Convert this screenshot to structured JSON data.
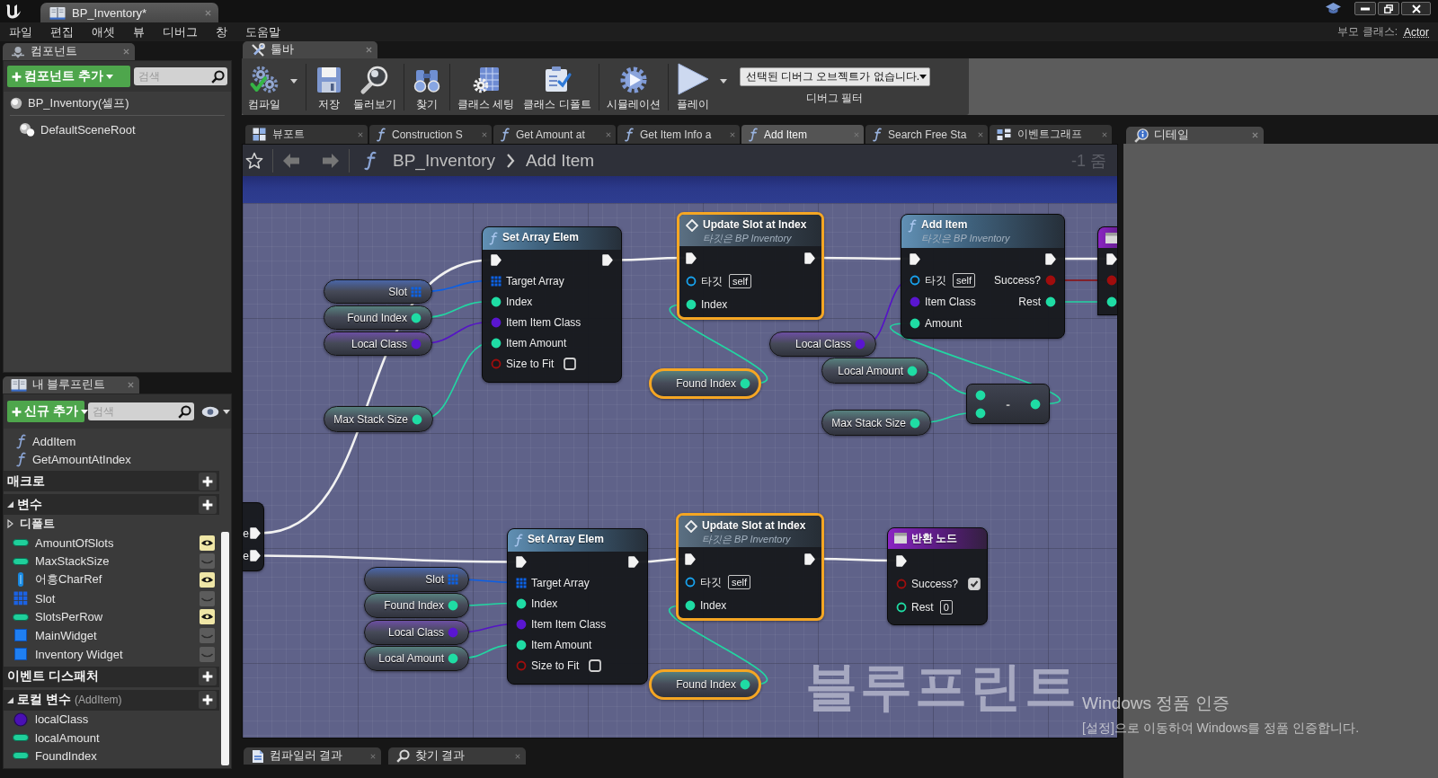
{
  "title_bar": {
    "tab": "BP_Inventory*"
  },
  "menu": [
    "파일",
    "편집",
    "애셋",
    "뷰",
    "디버그",
    "창",
    "도움말"
  ],
  "parent_class": {
    "label": "부모 클래스:",
    "value": "Actor"
  },
  "components": {
    "tab": "컴포넌트",
    "add_button": "컴포넌트 추가",
    "search": {
      "placeholder": "검색"
    },
    "items": [
      {
        "label": "BP_Inventory(셀프)",
        "kind": "actor",
        "children": [
          {
            "label": "DefaultSceneRoot",
            "kind": "scene"
          }
        ]
      }
    ]
  },
  "toolbar": {
    "tab": "툴바",
    "groups": [
      {
        "buttons": [
          {
            "label": "컴파일",
            "kind": "compile",
            "dropdown": true
          }
        ]
      },
      {
        "buttons": [
          {
            "label": "저장",
            "kind": "save",
            "dropdown": false
          },
          {
            "label": "둘러보기",
            "kind": "browse",
            "dropdown": false
          }
        ]
      },
      {
        "buttons": [
          {
            "label": "찾기",
            "kind": "find",
            "dropdown": false
          }
        ]
      },
      {
        "buttons": [
          {
            "label": "클래스 세팅",
            "kind": "class_settings",
            "dropdown": false
          },
          {
            "label": "클래스 디폴트",
            "kind": "class_defaults",
            "dropdown": false
          }
        ]
      },
      {
        "buttons": [
          {
            "label": "시뮬레이션",
            "kind": "simulate",
            "dropdown": false
          }
        ]
      },
      {
        "buttons": [
          {
            "label": "플레이",
            "kind": "play",
            "dropdown": true
          }
        ]
      }
    ],
    "debug_filter": {
      "value": "선택된 디버그 오브젝트가 없습니다.",
      "label": "디버그 필터"
    }
  },
  "document_tabs": [
    {
      "label": "뷰포트",
      "kind": "viewport",
      "selected": false
    },
    {
      "label": "Construction S",
      "kind": "function",
      "selected": false
    },
    {
      "label": "Get Amount at",
      "kind": "function",
      "selected": false
    },
    {
      "label": "Get Item Info a",
      "kind": "function",
      "selected": false
    },
    {
      "label": "Add Item",
      "kind": "function",
      "selected": true
    },
    {
      "label": "Search Free Sta",
      "kind": "function",
      "selected": false
    },
    {
      "label": "이벤트그래프",
      "kind": "graph",
      "selected": false
    }
  ],
  "details": {
    "tab": "디테일"
  },
  "breadcrumb": {
    "path": [
      "BP_Inventory",
      "Add Item"
    ],
    "zoom": "-1 줌"
  },
  "graph": {
    "nodes": [
      {
        "kind": "cut_left",
        "outputs": [
          {
            "kind": "exec",
            "label": "e",
            "connected": true
          },
          {
            "kind": "exec",
            "label": "e",
            "connected": true
          }
        ]
      },
      {
        "kind": "variable",
        "label": "Slot",
        "pin": {
          "kind": "array",
          "connected": true
        },
        "selected": false
      },
      {
        "kind": "variable",
        "label": "Found Index",
        "pin": {
          "kind": "int",
          "connected": true
        },
        "selected": false
      },
      {
        "kind": "variable",
        "label": "Local Class",
        "pin": {
          "kind": "class",
          "connected": true
        },
        "selected": false
      },
      {
        "kind": "variable",
        "label": "Max Stack Size",
        "pin": {
          "kind": "int",
          "connected": true
        },
        "selected": false
      },
      {
        "kind": "function",
        "title": "Set Array Elem",
        "selected": false,
        "inputs": [
          {
            "kind": "exec",
            "connected": true
          },
          {
            "kind": "array",
            "label": "Target Array",
            "connected": true
          },
          {
            "kind": "int",
            "label": "Index",
            "connected": true
          },
          {
            "kind": "class",
            "label": "Item Item Class",
            "connected": true
          },
          {
            "kind": "int",
            "label": "Item Amount",
            "connected": true
          },
          {
            "kind": "bool",
            "label": "Size to Fit",
            "connected": false,
            "checked": false
          }
        ],
        "outputs": [
          {
            "kind": "exec",
            "connected": true
          }
        ]
      },
      {
        "kind": "message",
        "title": "Update Slot at Index",
        "subtitle": "타깃은 BP Inventory",
        "selected": true,
        "inputs": [
          {
            "kind": "exec",
            "connected": true
          },
          {
            "kind": "object",
            "label": "타깃",
            "value": "self",
            "connected": false
          },
          {
            "kind": "int",
            "label": "Index",
            "connected": true
          }
        ],
        "outputs": [
          {
            "kind": "exec",
            "connected": true
          }
        ]
      },
      {
        "kind": "variable",
        "label": "Found Index",
        "pin": {
          "kind": "int",
          "connected": true
        },
        "selected": true
      },
      {
        "kind": "function",
        "title": "Add Item",
        "subtitle": "타깃은 BP Inventory",
        "selected": false,
        "inputs": [
          {
            "kind": "exec",
            "connected": true
          },
          {
            "kind": "object",
            "label": "타깃",
            "value": "self",
            "connected": false
          },
          {
            "kind": "class",
            "label": "Item Class",
            "connected": true
          },
          {
            "kind": "int",
            "label": "Amount",
            "connected": true
          }
        ],
        "outputs": [
          {
            "kind": "exec",
            "connected": true
          },
          {
            "kind": "bool",
            "label": "Success?",
            "connected": true
          },
          {
            "kind": "int",
            "label": "Rest",
            "connected": true
          }
        ]
      },
      {
        "kind": "variable",
        "label": "Local Class",
        "pin": {
          "kind": "class",
          "connected": true
        },
        "selected": false
      },
      {
        "kind": "variable",
        "label": "Local Amount",
        "pin": {
          "kind": "int",
          "connected": true
        },
        "selected": false
      },
      {
        "kind": "variable",
        "label": "Max Stack Size",
        "pin": {
          "kind": "int",
          "connected": true
        },
        "selected": false
      },
      {
        "kind": "operator",
        "symbol": "-",
        "selected": false,
        "inputs": [
          {
            "kind": "int",
            "connected": true
          },
          {
            "kind": "int",
            "connected": true
          }
        ],
        "outputs": [
          {
            "kind": "int",
            "connected": true
          }
        ]
      },
      {
        "kind": "cut_right",
        "inputs": [
          {
            "kind": "exec",
            "connected": true
          },
          {
            "kind": "bool",
            "connected": true
          },
          {
            "kind": "int",
            "connected": true
          }
        ]
      },
      {
        "kind": "function",
        "title": "Set Array Elem",
        "selected": false,
        "inputs": [
          {
            "kind": "exec",
            "connected": true
          },
          {
            "kind": "array",
            "label": "Target Array",
            "connected": true
          },
          {
            "kind": "int",
            "label": "Index",
            "connected": true
          },
          {
            "kind": "class",
            "label": "Item Item Class",
            "connected": true
          },
          {
            "kind": "int",
            "label": "Item Amount",
            "connected": true
          },
          {
            "kind": "bool",
            "label": "Size to Fit",
            "connected": false,
            "checked": false
          }
        ],
        "outputs": [
          {
            "kind": "exec",
            "connected": true
          }
        ]
      },
      {
        "kind": "variable",
        "label": "Slot",
        "pin": {
          "kind": "array",
          "connected": true
        },
        "selected": false
      },
      {
        "kind": "variable",
        "label": "Found Index",
        "pin": {
          "kind": "int",
          "connected": true
        },
        "selected": false
      },
      {
        "kind": "variable",
        "label": "Local Class",
        "pin": {
          "kind": "class",
          "connected": true
        },
        "selected": false
      },
      {
        "kind": "variable",
        "label": "Local Amount",
        "pin": {
          "kind": "int",
          "connected": true
        },
        "selected": false
      },
      {
        "kind": "message",
        "title": "Update Slot at Index",
        "subtitle": "타깃은 BP Inventory",
        "selected": true,
        "inputs": [
          {
            "kind": "exec",
            "connected": true
          },
          {
            "kind": "object",
            "label": "타깃",
            "value": "self",
            "connected": false
          },
          {
            "kind": "int",
            "label": "Index",
            "connected": true
          }
        ],
        "outputs": [
          {
            "kind": "exec",
            "connected": true
          }
        ]
      },
      {
        "kind": "variable",
        "label": "Found Index",
        "pin": {
          "kind": "int",
          "connected": true
        },
        "selected": true
      },
      {
        "kind": "return",
        "title": "반환 노드",
        "selected": false,
        "inputs": [
          {
            "kind": "exec",
            "connected": true
          },
          {
            "kind": "bool",
            "label": "Success?",
            "connected": false,
            "checked": true
          },
          {
            "kind": "int",
            "label": "Rest",
            "connected": false,
            "value": "0"
          }
        ]
      }
    ],
    "watermark": "블루프린트"
  },
  "bottom_tabs": [
    {
      "label": "컴파일러 결과",
      "kind": "compiler"
    },
    {
      "label": "찾기 결과",
      "kind": "find"
    }
  ],
  "my_blueprint": {
    "tab": "내 블루프린트",
    "add_button": "신규 추가",
    "search": {
      "placeholder": "검색"
    },
    "functions": [
      {
        "label": "AddItem"
      },
      {
        "label": "GetAmountAtIndex"
      }
    ],
    "sections": [
      {
        "title": "매크로"
      },
      {
        "title": "변수",
        "expanded": true,
        "items": [
          {
            "label": "디폴트",
            "kind": "category",
            "expanded": false
          },
          {
            "label": "AmountOfSlots",
            "kind": "int",
            "visible": true
          },
          {
            "label": "MaxStackSize",
            "kind": "int",
            "visible": false
          },
          {
            "label": "어흥CharRef",
            "kind": "object",
            "visible": true
          },
          {
            "label": "Slot",
            "kind": "array",
            "visible": false
          },
          {
            "label": "SlotsPerRow",
            "kind": "int",
            "visible": true
          },
          {
            "label": "MainWidget",
            "kind": "widget",
            "visible": false
          },
          {
            "label": "Inventory Widget",
            "kind": "widget",
            "visible": false
          }
        ]
      },
      {
        "title": "이벤트 디스패처"
      },
      {
        "title": "로컬 변수",
        "scope": "(AddItem)",
        "expanded": true,
        "items": [
          {
            "label": "localClass",
            "kind": "class"
          },
          {
            "label": "localAmount",
            "kind": "int"
          },
          {
            "label": "FoundIndex",
            "kind": "int"
          }
        ]
      }
    ]
  },
  "system_notice": {
    "title": "Windows 정품 인증",
    "message": "[설정]으로 이동하여 Windows를 정품 인증합니다."
  }
}
